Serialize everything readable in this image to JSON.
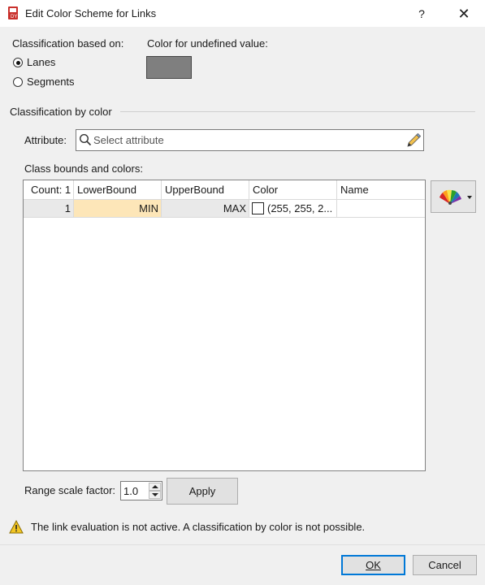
{
  "window": {
    "title": "Edit Color Scheme for Links",
    "help_label": "?",
    "close_label": "✕"
  },
  "classification_based_on": {
    "label": "Classification based on:",
    "options": [
      {
        "label": "Lanes",
        "selected": true
      },
      {
        "label": "Segments",
        "selected": false
      }
    ]
  },
  "undefined_color": {
    "label": "Color for undefined value:",
    "color": "#7f7f7f"
  },
  "color_group": {
    "label": "Classification by color"
  },
  "attribute": {
    "label": "Attribute:",
    "placeholder": "Select attribute"
  },
  "class_bounds": {
    "label": "Class bounds and colors:",
    "columns": [
      "Count: 1",
      "LowerBound",
      "UpperBound",
      "Color",
      "Name"
    ],
    "rows": [
      {
        "count": "1",
        "lower": "MIN",
        "upper": "MAX",
        "color": "(255, 255, 2...",
        "swatch": "#ffffff",
        "name": ""
      }
    ]
  },
  "range_scale": {
    "label": "Range scale factor:",
    "value": "1.0",
    "apply_label": "Apply"
  },
  "warning": {
    "text": "The link evaluation is not active. A classification by color is not possible."
  },
  "footer": {
    "ok_label": "OK",
    "cancel_label": "Cancel"
  },
  "colors": {
    "accent": "#0078d7",
    "lowerbound_highlight": "#fde6b8",
    "app_icon": "#c9302c"
  }
}
